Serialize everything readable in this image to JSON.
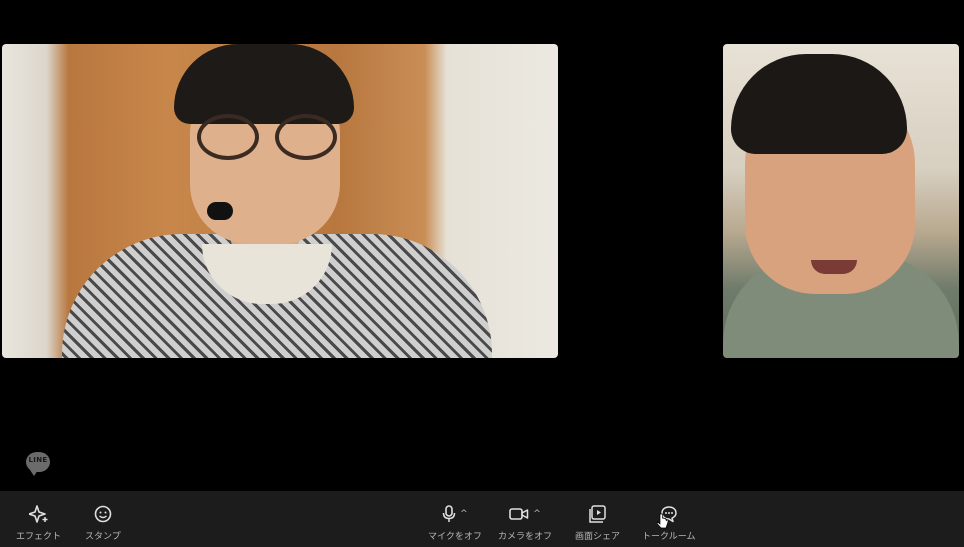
{
  "watermark": {
    "logo_text": "LINE"
  },
  "toolbar": {
    "effects_label": "エフェクト",
    "stamp_label": "スタンプ",
    "mic_label": "マイクをオフ",
    "camera_label": "カメラをオフ",
    "screen_share_label": "画面シェア",
    "talk_room_label": "トークルーム",
    "mic_caret": "^",
    "camera_caret": "^"
  },
  "icons": {
    "effects": "sparkle-icon",
    "stamp": "smiley-icon",
    "mic": "microphone-icon",
    "camera": "video-camera-icon",
    "screen_share": "screen-share-icon",
    "talk_room": "chat-bubble-icon"
  },
  "colors": {
    "background": "#000000",
    "toolbar": "#1c1c1c",
    "label": "#b8b8b8"
  }
}
